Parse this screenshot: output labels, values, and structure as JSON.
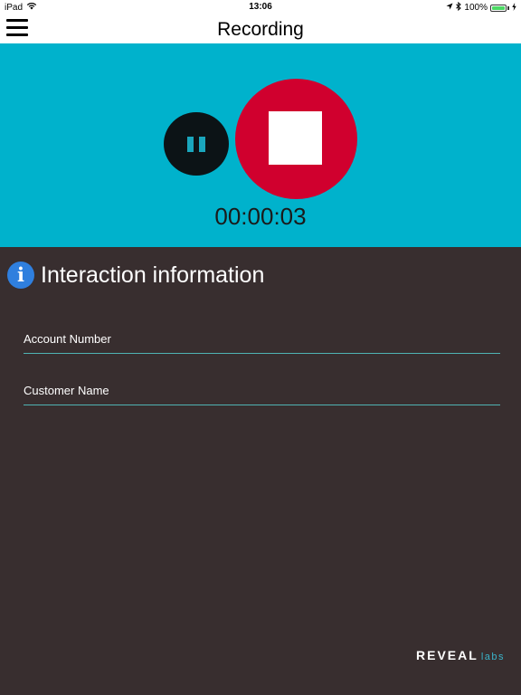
{
  "status_bar": {
    "device": "iPad",
    "time": "13:06",
    "battery": "100%",
    "battery_level": 1.0,
    "icons": [
      "wifi-icon",
      "location-arrow-icon",
      "bluetooth-icon",
      "battery-icon",
      "charging-bolt-icon"
    ]
  },
  "nav": {
    "title": "Recording",
    "menu_icon": "hamburger-menu-icon"
  },
  "recorder": {
    "timer": "00:00:03",
    "pause_icon": "pause-icon",
    "stop_icon": "stop-icon",
    "pause_color": "#0c1316",
    "stop_color": "#d0002e",
    "panel_color": "#00b2cc"
  },
  "interaction": {
    "title": "Interaction information",
    "info_glyph": "i",
    "fields": {
      "account_number": {
        "placeholder": "Account Number",
        "value": ""
      },
      "customer_name": {
        "placeholder": "Customer Name",
        "value": ""
      }
    }
  },
  "logo": {
    "main": "REVEAL",
    "sub": "labs"
  }
}
